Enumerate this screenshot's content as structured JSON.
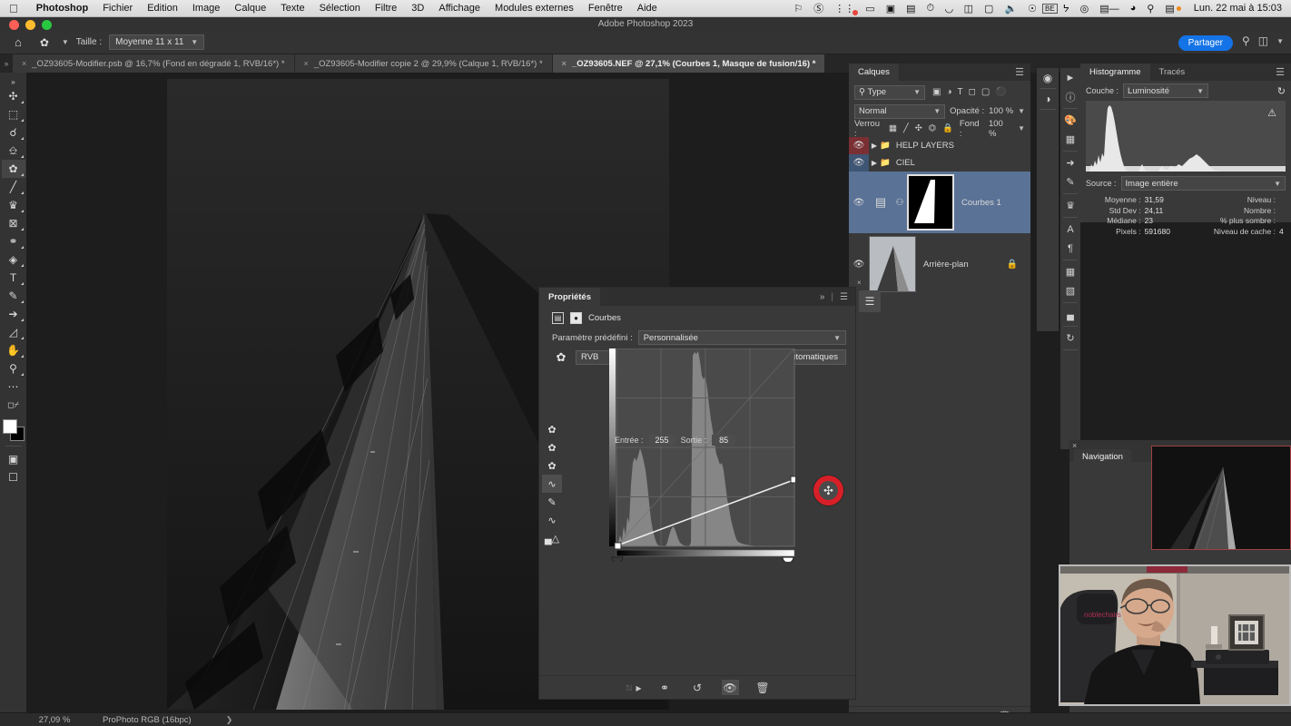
{
  "macbar": {
    "apple_icon": "apple-icon",
    "app_name": "Photoshop",
    "menus": [
      "Fichier",
      "Edition",
      "Image",
      "Calque",
      "Texte",
      "Sélection",
      "Filtre",
      "3D",
      "Affichage",
      "Modules externes",
      "Fenêtre",
      "Aide"
    ],
    "status_icons": [
      "vpn-icon",
      "dnd-icon",
      "notifications-icon",
      "screen-record-icon",
      "screenshot-icon",
      "clipboard-icon",
      "timemachine-icon",
      "binoculars-icon",
      "splitview-icon",
      "display-icon",
      "volume-icon",
      "siri-icon",
      "keyboard-be-icon",
      "bluetooth-icon",
      "location-icon",
      "battery-icon",
      "wifi-icon",
      "spotlight-icon",
      "controlcenter-icon"
    ],
    "keyboard_layout": "BE",
    "clock": "Lun. 22 mai à 15:03"
  },
  "window": {
    "title": "Adobe Photoshop 2023"
  },
  "options_bar": {
    "home_icon": "home-icon",
    "tool_icon": "eyedropper-icon",
    "size_label": "Taille :",
    "size_value": "Moyenne 11 x 11",
    "share_label": "Partager",
    "search_icon": "search-icon",
    "workspace_icon": "workspace-icon",
    "chevron_icon": "chevron-down-icon"
  },
  "tabs": [
    {
      "label": "_OZ93605-Modifier.psb @ 16,7% (Fond en dégradé 1, RVB/16*) *",
      "active": false
    },
    {
      "label": "_OZ93605-Modifier copie 2 @ 29,9% (Calque 1, RVB/16*) *",
      "active": false
    },
    {
      "label": "_OZ93605.NEF @ 27,1% (Courbes 1, Masque de fusion/16) *",
      "active": true
    }
  ],
  "toolbar": {
    "tools": [
      "move-icon",
      "marquee-icon",
      "lasso-icon",
      "object-select-icon",
      "eyedropper-icon",
      "brush-icon",
      "clone-stamp-icon",
      "eraser-icon",
      "blur-icon",
      "paint-bucket-icon",
      "type-icon",
      "pen-icon",
      "path-select-icon",
      "shape-icon",
      "hand-icon",
      "zoom-icon",
      "more-tools-icon"
    ],
    "quickmask_icon": "quick-mask-icon",
    "screenmode_icon": "screen-mode-icon",
    "swap_icon": "swap-colors-icon",
    "default_icon": "default-colors-icon"
  },
  "status_bar": {
    "zoom": "27,09 %",
    "color_profile": "ProPhoto RGB (16bpc)",
    "arrow_icon": "chevron-right-icon"
  },
  "layers_panel": {
    "tabs": [
      {
        "label": "Calques",
        "active": true
      }
    ],
    "menu_icon": "panel-menu-icon",
    "filter_label": "Type",
    "filter_search_icon": "search-icon",
    "filter_icons": [
      "pixel-filter-icon",
      "adjustment-filter-icon",
      "type-filter-icon",
      "shape-filter-icon",
      "smartobject-filter-icon",
      "toggle-filter-icon"
    ],
    "blend_mode": "Normal",
    "opacity_label": "Opacité :",
    "opacity_value": "100 %",
    "lock_label": "Verrou :",
    "lock_icons": [
      "lock-transparency-icon",
      "lock-image-icon",
      "lock-position-icon",
      "lock-artboard-icon",
      "lock-all-icon"
    ],
    "fill_label": "Fond :",
    "fill_value": "100 %",
    "layers": [
      {
        "name": "HELP LAYERS",
        "type": "group",
        "eye": "eye-icon",
        "eye_color": "#7a2f33",
        "selected": false
      },
      {
        "name": "CIEL",
        "type": "group",
        "eye": "eye-icon",
        "eye_color": "#3f5574",
        "selected": false
      },
      {
        "name": "Courbes 1",
        "type": "adjustment",
        "eye": "eye-icon",
        "selected": true
      },
      {
        "name": "Arrière-plan",
        "type": "background",
        "eye": "eye-icon",
        "locked": true,
        "selected": false
      }
    ],
    "bottom_icons": [
      "link-layers-icon",
      "layer-style-fx-icon",
      "layer-mask-icon",
      "adjustment-layer-icon",
      "new-group-icon",
      "new-layer-icon",
      "delete-layer-icon"
    ]
  },
  "dock_icons": {
    "column_a": [
      "color-wheel-icon",
      "adjustments-icon"
    ],
    "column_b": [
      "play-icon",
      "info-icon",
      "swatches-icon",
      "patterns-icon",
      "actions-icon",
      "brush-settings-icon",
      "clone-source-icon",
      "character-icon",
      "paragraph-icon",
      "notes-icon",
      "layer-comps-icon",
      "histogram-icon",
      "history-icon"
    ]
  },
  "histogram_panel": {
    "tabs": [
      {
        "label": "Histogramme",
        "active": true
      },
      {
        "label": "Tracés",
        "active": false
      }
    ],
    "menu_icon": "panel-menu-icon",
    "channel_label": "Couche :",
    "channel_value": "Luminosité",
    "refresh_icon": "refresh-icon",
    "warning_icon": "cached-data-warning-icon",
    "source_label": "Source :",
    "source_value": "Image entière",
    "stats": [
      {
        "label": "Moyenne :",
        "value": "31,59",
        "label2": "Niveau :",
        "value2": ""
      },
      {
        "label": "Std Dev :",
        "value": "24,11",
        "label2": "Nombre :",
        "value2": ""
      },
      {
        "label": "Médiane :",
        "value": "23",
        "label2": "% plus sombre :",
        "value2": ""
      },
      {
        "label": "Pixels :",
        "value": "591680",
        "label2": "Niveau de cache :",
        "value2": "4"
      }
    ]
  },
  "properties_panel": {
    "title": "Propriétés",
    "collapse_icon": "double-chevron-icon",
    "menu_icon": "panel-menu-icon",
    "header_label": "Courbes",
    "header_icons": [
      "curves-icon",
      "mask-icon"
    ],
    "preset_label": "Paramètre prédéfini :",
    "preset_value": "Personnalisée",
    "channel_value": "RVB",
    "auto_label": "Automatiques",
    "targeted_adjust_icon": "targeted-adjustment-icon",
    "curve_tools": [
      "black-point-eyedropper-icon",
      "gray-point-eyedropper-icon",
      "white-point-eyedropper-icon",
      "curve-point-tool-icon",
      "pencil-draw-curve-icon",
      "smooth-curve-icon",
      "histogram-display-icon"
    ],
    "selected_curve_tool": 3,
    "input_label": "Entrée :",
    "input_value": "255",
    "output_label": "Sortie :",
    "output_value": "85",
    "bottom_icons": [
      "clip-to-layer-icon",
      "toggle-view-icon",
      "reset-icon",
      "visibility-icon",
      "delete-icon"
    ]
  },
  "navigation_panel": {
    "close_icon": "close-icon",
    "tab_label": "Navigation",
    "view_box_color": "#9e4141"
  },
  "cursor": {
    "badge_color": "#d81f27",
    "icon": "move-cursor-icon"
  },
  "chart_data": {
    "type": "line",
    "title": "Courbes RVB",
    "xlabel": "Entrée",
    "ylabel": "Sortie",
    "xlim": [
      0,
      255
    ],
    "ylim": [
      0,
      255
    ],
    "grid": true,
    "points": [
      {
        "input": 0,
        "output": 0
      },
      {
        "input": 255,
        "output": 85
      }
    ],
    "black_point": 0,
    "white_point": 255,
    "histogram_note": "background luminance histogram with dominant dark peak near level 30 and secondary peak near level 10"
  }
}
